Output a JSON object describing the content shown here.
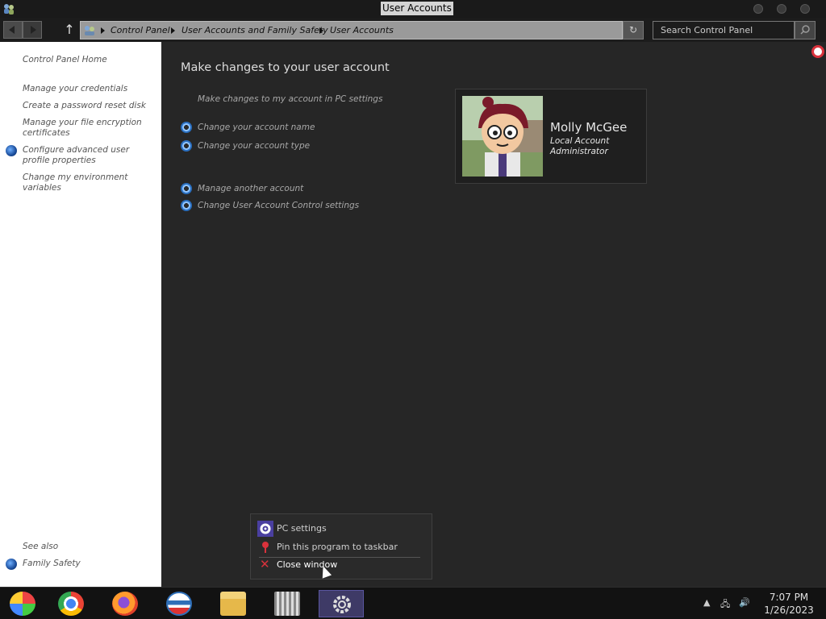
{
  "window": {
    "title": "User Accounts"
  },
  "address": {
    "crumbs": [
      "Control Panel",
      "User Accounts and Family Safety",
      "User Accounts"
    ]
  },
  "search": {
    "placeholder": "Search Control Panel"
  },
  "sidebar": {
    "home": "Control Panel Home",
    "links": [
      "Manage your credentials",
      "Create a password reset disk",
      "Manage your file encryption certificates",
      "Configure advanced user profile properties",
      "Change my environment variables"
    ],
    "see_also": "See also",
    "family_safety": "Family Safety"
  },
  "main": {
    "title": "Make changes to your user account",
    "pc_settings_link": "Make changes to my account in PC settings",
    "actions": [
      "Change your account name",
      "Change your account type",
      "Manage another account",
      "Change User Account Control settings"
    ]
  },
  "user": {
    "name": "Molly McGee",
    "account_type": "Local Account",
    "role": "Administrator"
  },
  "context_menu": {
    "items": [
      "PC settings",
      "Pin this program to taskbar",
      "Close window"
    ]
  },
  "taskbar": {
    "apps": [
      "media-center-icon",
      "chrome-icon",
      "firefox-icon",
      "outlook-icon",
      "file-explorer-icon",
      "store-icon",
      "settings-icon"
    ],
    "time": "7:07 PM",
    "date": "1/26/2023"
  },
  "colors": {
    "accent": "#3e3a66",
    "link_blue": "#2a6fc0",
    "close_red": "#d9323c"
  }
}
